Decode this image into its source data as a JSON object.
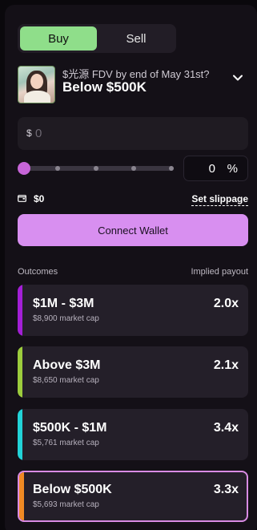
{
  "trade_toggle": {
    "buy_label": "Buy",
    "sell_label": "Sell",
    "selected": "Buy"
  },
  "market": {
    "question": "$光源 FDV by end of May 31st?",
    "selected_outcome": "Below $500K",
    "icon": "chevron-down-icon"
  },
  "amount": {
    "currency_symbol": "$",
    "placeholder": "0",
    "value": ""
  },
  "slider": {
    "level_percent": 0
  },
  "percent_box": {
    "value": "0",
    "unit": "%"
  },
  "wallet": {
    "icon": "wallet-icon",
    "balance": "$0",
    "slippage_label": "Set slippage"
  },
  "connect_button": {
    "label": "Connect Wallet"
  },
  "outcomes_header": {
    "left": "Outcomes",
    "right": "Implied payout"
  },
  "outcomes": [
    {
      "name": "$1M - $3M",
      "market_cap": "$8,900 market cap",
      "payout": "2.0x",
      "color": "#a31fd6",
      "selected": false
    },
    {
      "name": "Above $3M",
      "market_cap": "$8,650 market cap",
      "payout": "2.1x",
      "color": "#9ccc3d",
      "selected": false
    },
    {
      "name": "$500K - $1M",
      "market_cap": "$5,761 market cap",
      "payout": "3.4x",
      "color": "#22d3d8",
      "selected": false
    },
    {
      "name": "Below $500K",
      "market_cap": "$5,693 market cap",
      "payout": "3.3x",
      "color": "#f08a24",
      "selected": true
    }
  ],
  "colors": {
    "buy_active": "#8fde8a",
    "connect": "#d88ff0",
    "slider_knob": "#c765d8",
    "selected_border": "#d98be4"
  }
}
